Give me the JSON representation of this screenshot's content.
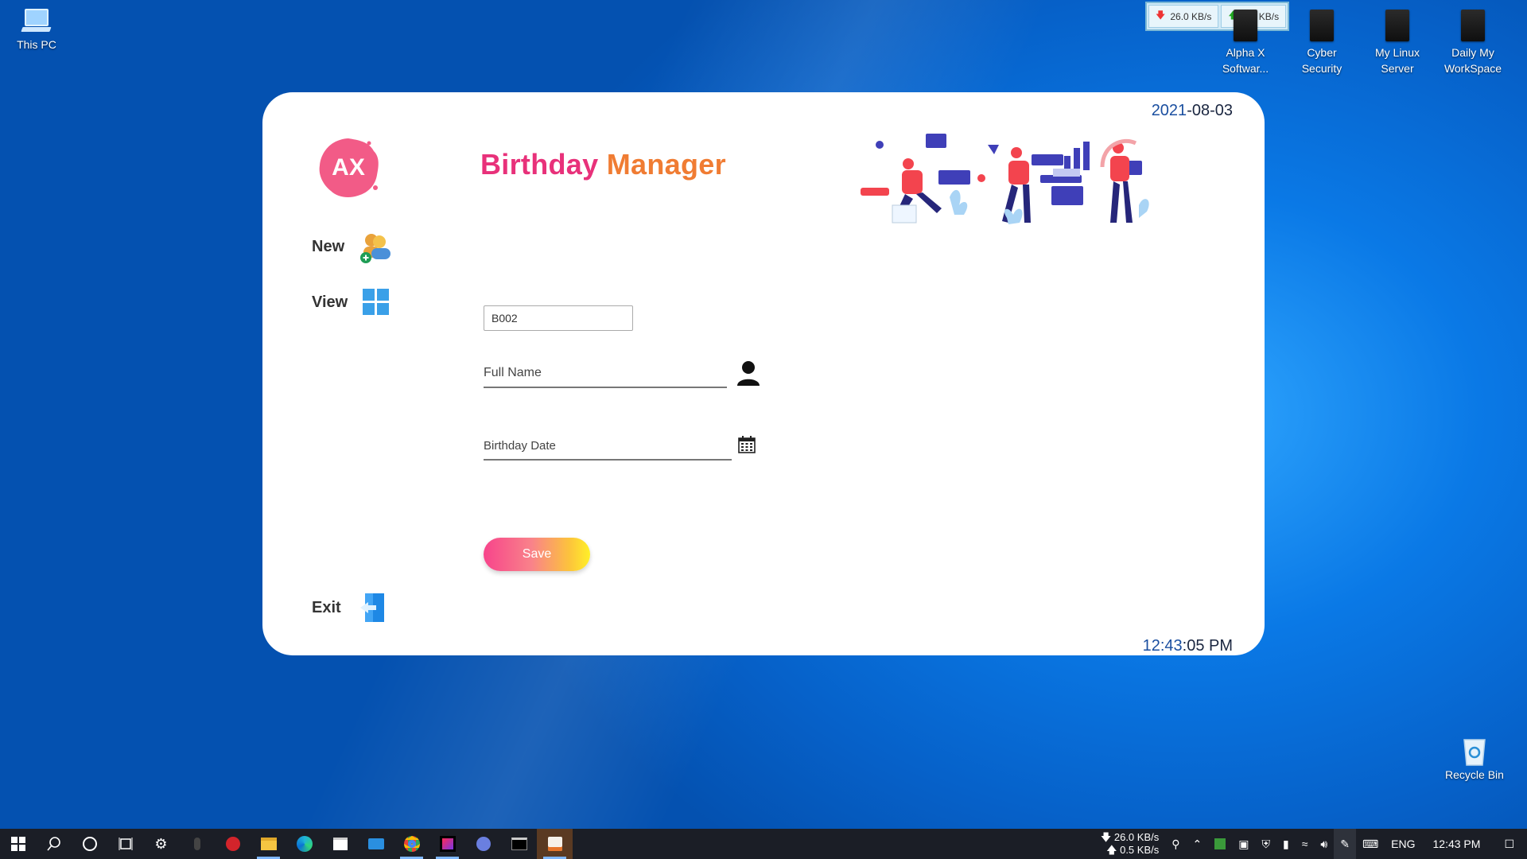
{
  "desktop": {
    "icons": [
      {
        "label": "This PC"
      },
      {
        "label": "Alpha X Softwar..."
      },
      {
        "label": "Cyber Security"
      },
      {
        "label": "My Linux Server"
      },
      {
        "label": "Daily My WorkSpace"
      },
      {
        "label": "Recycle Bin"
      }
    ],
    "netmeter": {
      "down": "26.0 KB/s",
      "up": "0.5 KB/s"
    }
  },
  "app": {
    "date": {
      "year": "2021",
      "rest": "-08-03"
    },
    "time": {
      "hm": "12:43",
      "rest": ":05 PM"
    },
    "logo_text": "AX",
    "title": {
      "part1": "Birthday",
      "part2": "Manager"
    },
    "nav": {
      "new": "New",
      "view": "View",
      "exit": "Exit"
    },
    "form": {
      "id_value": "B002",
      "fullname_placeholder": "Full Name",
      "birthday_placeholder": "Birthday Date",
      "save_label": "Save"
    },
    "colors": {
      "title_pink": "#e8317a",
      "title_orange": "#f07c33",
      "time_blue": "#1b4fa0"
    }
  },
  "taskbar": {
    "net_down": "26.0 KB/s",
    "net_up": "0.5 KB/s",
    "lang": "ENG",
    "clock": "12:43 PM"
  }
}
